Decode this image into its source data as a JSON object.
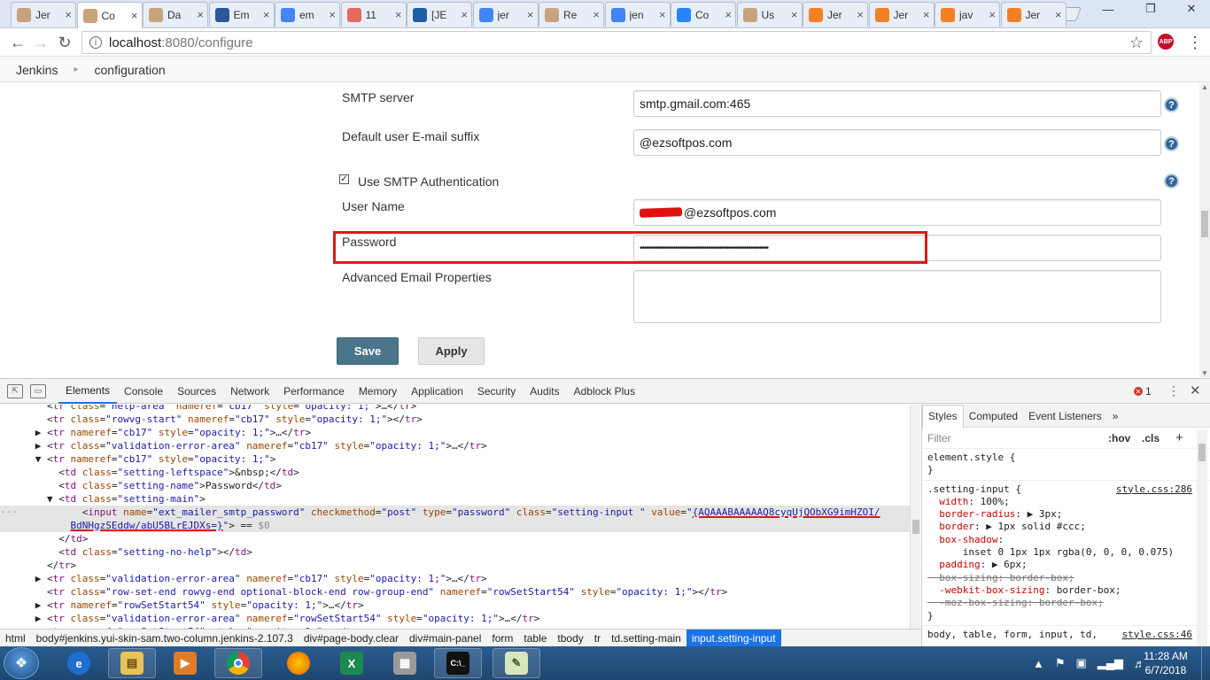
{
  "browser": {
    "tabs": [
      {
        "label": "Jer",
        "icon": "jenkins-icon",
        "color": "#c9a27e"
      },
      {
        "label": "Co",
        "icon": "jenkins-icon",
        "color": "#c9a27e",
        "active": true
      },
      {
        "label": "Da",
        "icon": "jenkins-icon",
        "color": "#c9a27e"
      },
      {
        "label": "Em",
        "icon": "tools-icon",
        "color": "#2b5797"
      },
      {
        "label": "em",
        "icon": "google-icon",
        "color": "#4285f4"
      },
      {
        "label": "11",
        "icon": "tumblr-icon",
        "color": "#e66a5c"
      },
      {
        "label": "[JE",
        "icon": "jira-icon",
        "color": "#1f5ea8"
      },
      {
        "label": "jer",
        "icon": "google-icon",
        "color": "#4285f4"
      },
      {
        "label": "Re",
        "icon": "jenkins-icon",
        "color": "#c9a27e"
      },
      {
        "label": "jen",
        "icon": "google-icon",
        "color": "#4285f4"
      },
      {
        "label": "Co",
        "icon": "confluence-icon",
        "color": "#2684ff"
      },
      {
        "label": "Us",
        "icon": "jenkins-icon",
        "color": "#c9a27e"
      },
      {
        "label": "Jer",
        "icon": "stackoverflow-icon",
        "color": "#f48024"
      },
      {
        "label": "Jer",
        "icon": "stackoverflow-icon",
        "color": "#f48024"
      },
      {
        "label": "jav",
        "icon": "stackoverflow-icon",
        "color": "#f48024"
      },
      {
        "label": "Jer",
        "icon": "stackoverflow-icon",
        "color": "#f48024"
      }
    ],
    "url_host": "localhost",
    "url_path": ":8080/configure",
    "abp_label": "ABP"
  },
  "breadcrumb": {
    "root": "Jenkins",
    "page": "configuration"
  },
  "config": {
    "smtp_server_label": "SMTP server",
    "smtp_server_value": "smtp.gmail.com:465",
    "suffix_label": "Default user E-mail suffix",
    "suffix_value": "@ezsoftpos.com",
    "use_auth_label": "Use SMTP Authentication",
    "username_label": "User Name",
    "username_value": "@ezsoftpos.com",
    "password_label": "Password",
    "password_value": "••••••••••••••••••••••••••••••••••••••••••••••••••••••••••",
    "advanced_label": "Advanced Email Properties",
    "save_label": "Save",
    "apply_label": "Apply"
  },
  "devtools": {
    "tabs": [
      "Elements",
      "Console",
      "Sources",
      "Network",
      "Performance",
      "Memory",
      "Application",
      "Security",
      "Audits",
      "Adblock Plus"
    ],
    "error_count": "1",
    "breadcrumbs": [
      "html",
      "body#jenkins.yui-skin-sam.two-column.jenkins-2.107.3",
      "div#page-body.clear",
      "div#main-panel",
      "form",
      "table",
      "tbody",
      "tr",
      "td.setting-main",
      "input.setting-input"
    ],
    "style_tabs": [
      "Styles",
      "Computed",
      "Event Listeners",
      "»"
    ],
    "filter_placeholder": "Filter",
    "hov": ":hov",
    "cls": ".cls",
    "element_style": "element.style {",
    "rule_selector": ".setting-input {",
    "rule_source": "style.css:286",
    "props": [
      {
        "name": "width",
        "value": "100%;"
      },
      {
        "name": "border-radius",
        "value": "▶ 3px;"
      },
      {
        "name": "border",
        "value": "▶ 1px solid #ccc;"
      },
      {
        "name": "box-shadow",
        "value": ""
      },
      {
        "name": "",
        "value": "inset 0 1px 1px rgba(0, 0, 0, 0.075)"
      },
      {
        "name": "padding",
        "value": "▶ 6px;"
      },
      {
        "name": "box-sizing",
        "value": "border-box;",
        "struck": true
      },
      {
        "name": "-webkit-box-sizing",
        "value": "border-box;"
      },
      {
        "name": "-moz-box-sizing",
        "value": "border-box;",
        "struck": true
      }
    ],
    "bottom_selector": "body, table, form, input, td,",
    "bottom_source": "style.css:46"
  },
  "taskbar": {
    "time": "11:28 AM",
    "date": "6/7/2018"
  }
}
